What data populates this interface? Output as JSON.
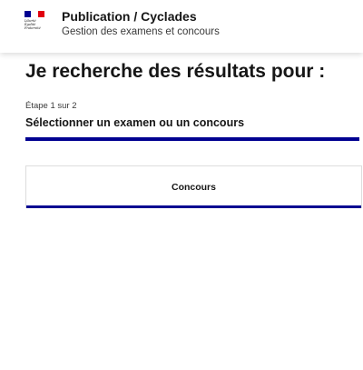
{
  "header": {
    "logo": {
      "motto": [
        "Liberté",
        "Égalité",
        "Fraternité"
      ],
      "flag_colors": [
        "#000091",
        "#ffffff",
        "#e1000f"
      ]
    },
    "service_title": "Publication / Cyclades",
    "service_tagline": "Gestion des examens et concours"
  },
  "main": {
    "title": "Je recherche des résultats pour :",
    "stepper": {
      "step_count": "Étape 1 sur 2",
      "current_step": 1,
      "total_steps": 2,
      "step_title": "Sélectionner un examen ou un concours"
    },
    "options": [
      {
        "label": "Concours"
      }
    ]
  },
  "colors": {
    "accent": "#000091",
    "text": "#161616",
    "muted_text": "#3a3a3a",
    "border": "#dddddd"
  }
}
